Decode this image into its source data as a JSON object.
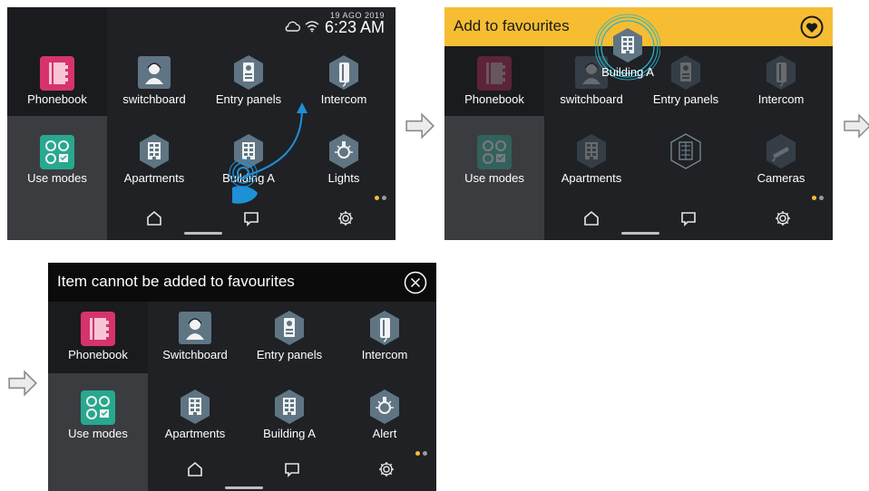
{
  "colors": {
    "panel_bg": "#1f2125",
    "phonebook_icon": "#d6336c",
    "use_modes_icon": "#27a88f",
    "hex_icon": "#5f7583",
    "add_banner": "#f6bd33",
    "error_banner": "#0b0b0b",
    "dot_active": "#f6bd33",
    "dot_inactive": "#9a9a9a",
    "drag_accent": "#1e90d6"
  },
  "panel1": {
    "date": "19 AGO 2019",
    "time": "6:23 AM",
    "left": [
      "Phonebook",
      "Use modes"
    ],
    "tiles_row1": [
      "switchboard",
      "Entry panels",
      "Intercom"
    ],
    "tiles_row2": [
      "Apartments",
      "Building A",
      "Lights"
    ]
  },
  "panel2": {
    "banner_text": "Add to favourites",
    "dragged_label": "Building A",
    "left": [
      "Phonebook",
      "Use modes"
    ],
    "tiles_row1": [
      "switchboard",
      "Entry panels",
      "Intercom"
    ],
    "tiles_row2": [
      "Apartments",
      "Cameras"
    ]
  },
  "panel3": {
    "banner_text": "Item cannot be added to favourites",
    "left": [
      "Phonebook",
      "Use modes"
    ],
    "tiles_row1": [
      "Switchboard",
      "Entry panels",
      "Intercom"
    ],
    "tiles_row2": [
      "Apartments",
      "Building A",
      "Alert"
    ]
  },
  "icons": {
    "home": "home-icon",
    "chat": "chat-icon",
    "settings": "gear-icon",
    "cloud": "cloud-icon",
    "wifi": "wifi-icon",
    "heart": "heart-icon",
    "close": "close-icon",
    "step_arrow": "right-arrow-icon"
  }
}
